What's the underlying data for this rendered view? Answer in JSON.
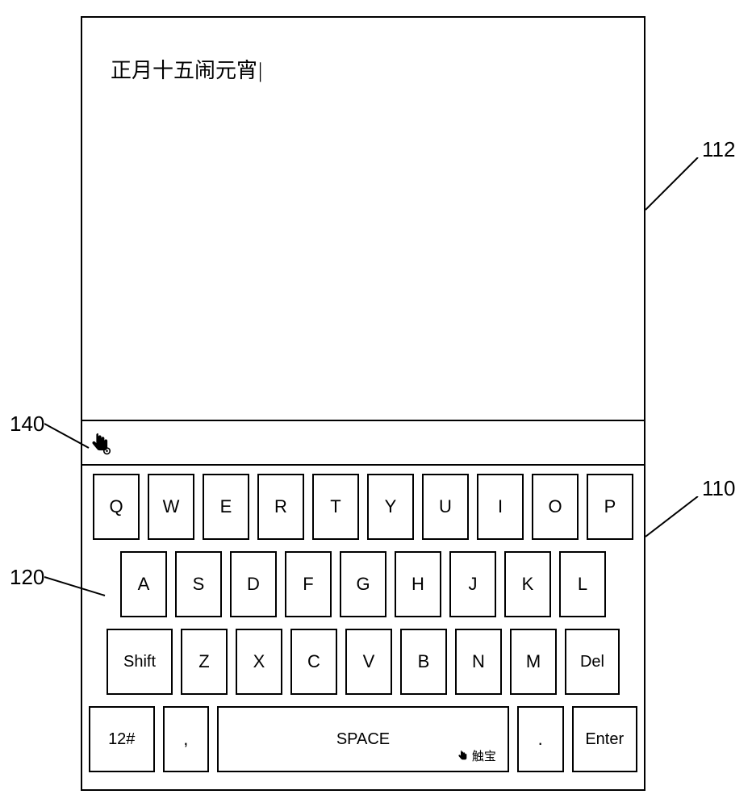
{
  "text_area": {
    "typed_text": "正月十五闹元宵"
  },
  "keyboard": {
    "row1": [
      "Q",
      "W",
      "E",
      "R",
      "T",
      "Y",
      "U",
      "I",
      "O",
      "P"
    ],
    "row2": [
      "A",
      "S",
      "D",
      "F",
      "G",
      "H",
      "J",
      "K",
      "L"
    ],
    "row3": {
      "shift": "Shift",
      "letters": [
        "Z",
        "X",
        "C",
        "V",
        "B",
        "N",
        "M"
      ],
      "del": "Del"
    },
    "row4": {
      "numsym": "12#",
      "comma": ",",
      "space": "SPACE",
      "space_brand": "触宝",
      "dot": ".",
      "enter": "Enter"
    }
  },
  "callouts": {
    "c112": "112",
    "c110": "110",
    "c120": "120",
    "c140": "140"
  }
}
